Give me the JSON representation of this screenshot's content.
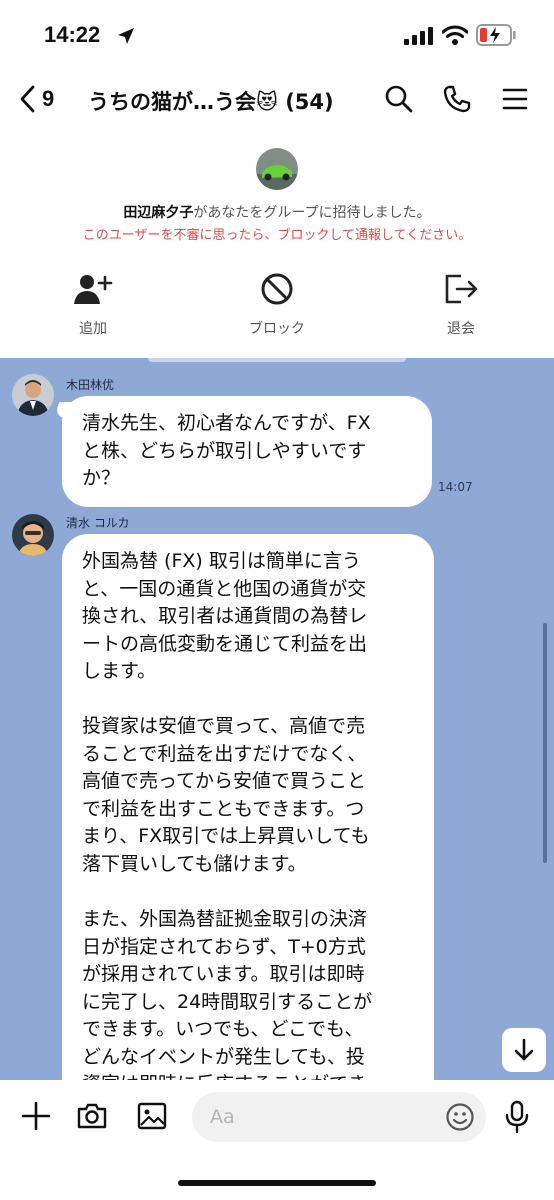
{
  "status_bar": {
    "time": "14:22"
  },
  "header": {
    "back_count": "9",
    "title": "うちの猫が…う会😻 (54)"
  },
  "invite": {
    "inviter_name": "田辺麻夕子",
    "invite_message": "があなたをグループに招待しました。",
    "warning": "このユーザーを不審に思ったら、ブロックして通報してください。",
    "actions": [
      {
        "label": "追加",
        "icon": "add-friend-icon"
      },
      {
        "label": "ブロック",
        "icon": "block-icon"
      },
      {
        "label": "退会",
        "icon": "leave-icon"
      }
    ]
  },
  "messages": [
    {
      "sender": "木田林优",
      "text": "清水先生、初心者なんですが、FX\nと株、どちらが取引しやすいです\nか？",
      "time": "14:07"
    },
    {
      "sender": "清水 コルカ",
      "text": "外国為替 (FX) 取引は簡単に言う\nと、一国の通貨と他国の通貨が交\n換され、取引者は通貨間の為替レ\nートの高低変動を通じて利益を出\nします。\n\n投資家は安値で買って、高値で売\nることで利益を出すだけでなく、\n高値で売ってから安値で買うこと\nで利益を出すこともできます。つ\nまり、FX取引では上昇買いしても\n落下買いしても儲けます。\n\nまた、外国為替証拠金取引の決済\n日が指定されておらず、T+0方式\nが採用されています。取引は即時\nに完了し、24時間取引することが\nできます。いつでも、どこでも、\nどんなイベントが発生しても、投\n資家は即時に反応することができ"
    }
  ],
  "input": {
    "placeholder": "Aa"
  },
  "colors": {
    "chat_bg": "#8fa9d6",
    "warning": "#e04b4b"
  }
}
